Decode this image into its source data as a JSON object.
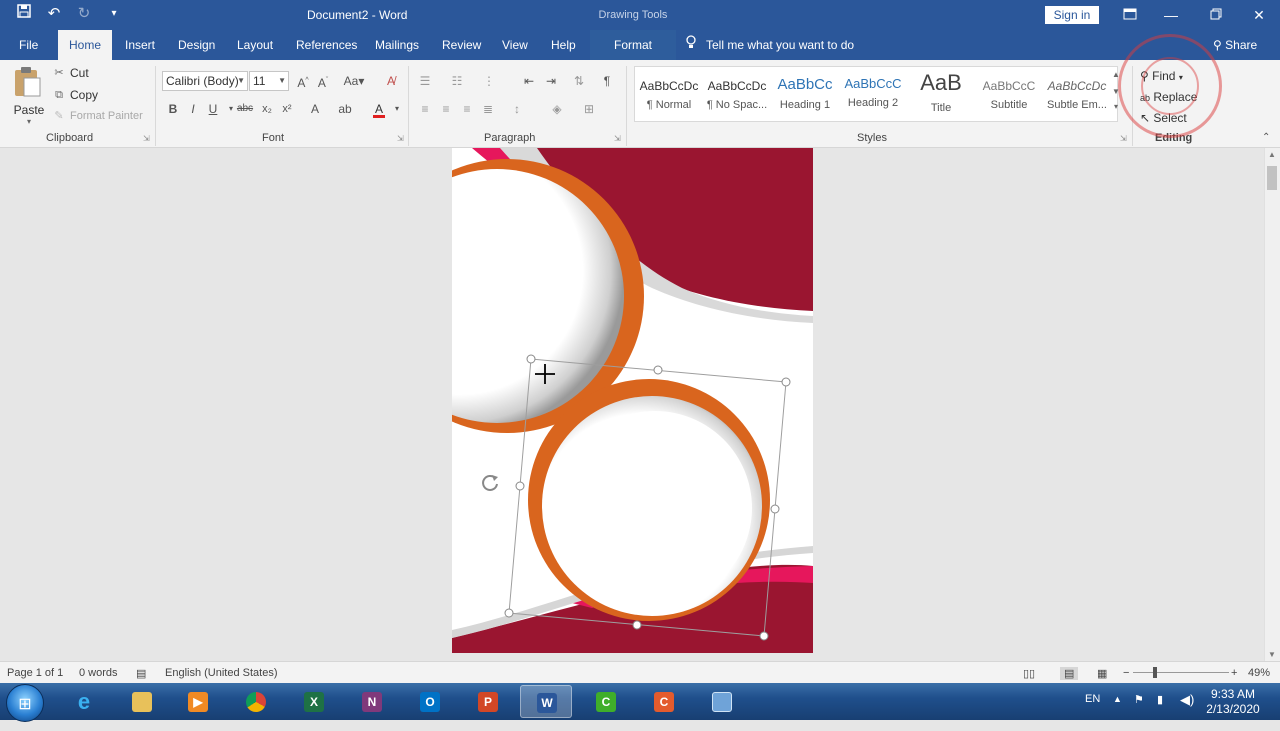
{
  "title_bar": {
    "doc_title": "Document2 - Word",
    "context_label": "Drawing Tools",
    "sign_in": "Sign in"
  },
  "tabs": [
    {
      "label": "File"
    },
    {
      "label": "Home"
    },
    {
      "label": "Insert"
    },
    {
      "label": "Design"
    },
    {
      "label": "Layout"
    },
    {
      "label": "References"
    },
    {
      "label": "Mailings"
    },
    {
      "label": "Review"
    },
    {
      "label": "View"
    },
    {
      "label": "Help"
    },
    {
      "label": "Format"
    }
  ],
  "tell_me": "Tell me what you want to do",
  "share": "Share",
  "clipboard": {
    "paste": "Paste",
    "cut": "Cut",
    "copy": "Copy",
    "format_painter": "Format Painter",
    "group": "Clipboard"
  },
  "font": {
    "family": "Calibri (Body)",
    "size": "11",
    "group": "Font"
  },
  "paragraph": {
    "group": "Paragraph"
  },
  "styles": {
    "group": "Styles",
    "items": [
      {
        "preview": "AaBbCcDc",
        "name": "¶ Normal"
      },
      {
        "preview": "AaBbCcDc",
        "name": "¶ No Spac..."
      },
      {
        "preview": "AaBbCc",
        "name": "Heading 1"
      },
      {
        "preview": "AaBbCcC",
        "name": "Heading 2"
      },
      {
        "preview": "AaB",
        "name": "Title"
      },
      {
        "preview": "AaBbCcC",
        "name": "Subtitle"
      },
      {
        "preview": "AaBbCcDc",
        "name": "Subtle Em..."
      }
    ]
  },
  "editing": {
    "find": "Find",
    "replace": "Replace",
    "select": "Select",
    "group": "Editing"
  },
  "status": {
    "page": "Page 1 of 1",
    "words": "0 words",
    "language": "English (United States)",
    "zoom": "49%"
  },
  "taskbar": {
    "lang": "EN",
    "time": "9:33 AM",
    "date": "2/13/2020"
  },
  "accent": "#2b579a"
}
